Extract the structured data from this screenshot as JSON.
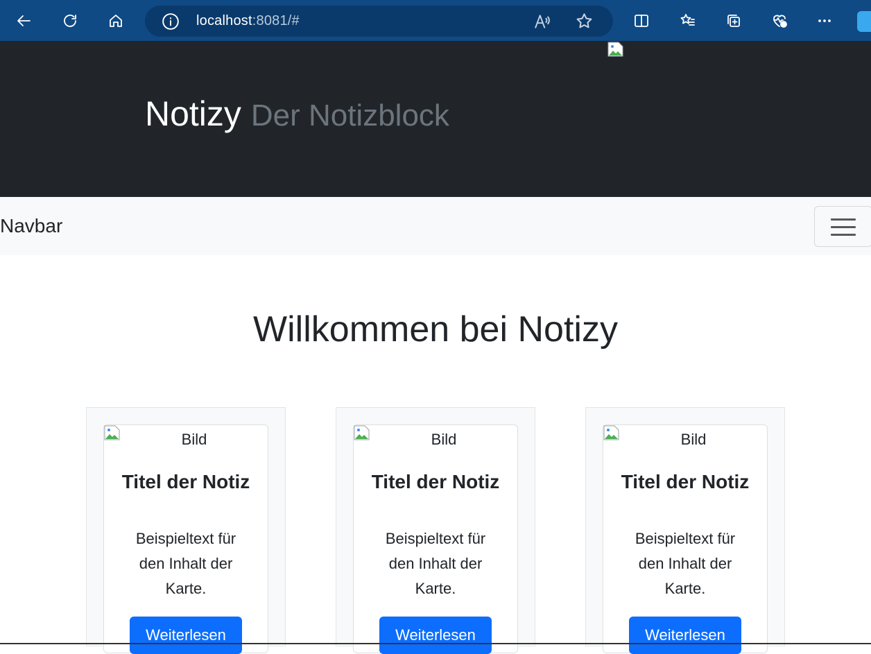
{
  "browser": {
    "url_host": "localhost",
    "url_rest": ":8081/#",
    "read_aloud": "Aʾ"
  },
  "header": {
    "title": "Notizy",
    "subtitle": "Der Notizblock"
  },
  "navbar": {
    "brand": "Navbar"
  },
  "main": {
    "heading": "Willkommen bei Notizy",
    "cards": [
      {
        "img_alt": "Bild",
        "title": "Titel der Notiz",
        "text": "Beispieltext für den Inhalt der Karte.",
        "button": "Weiterlesen"
      },
      {
        "img_alt": "Bild",
        "title": "Titel der Notiz",
        "text": "Beispieltext für den Inhalt der Karte.",
        "button": "Weiterlesen"
      },
      {
        "img_alt": "Bild",
        "title": "Titel der Notiz",
        "text": "Beispieltext für den Inhalt der Karte.",
        "button": "Weiterlesen"
      }
    ]
  },
  "colors": {
    "header_bg": "#212529",
    "navbar_bg": "#f8f9fa",
    "primary": "#0d6efd",
    "browser_bar": "#0f4a85"
  }
}
